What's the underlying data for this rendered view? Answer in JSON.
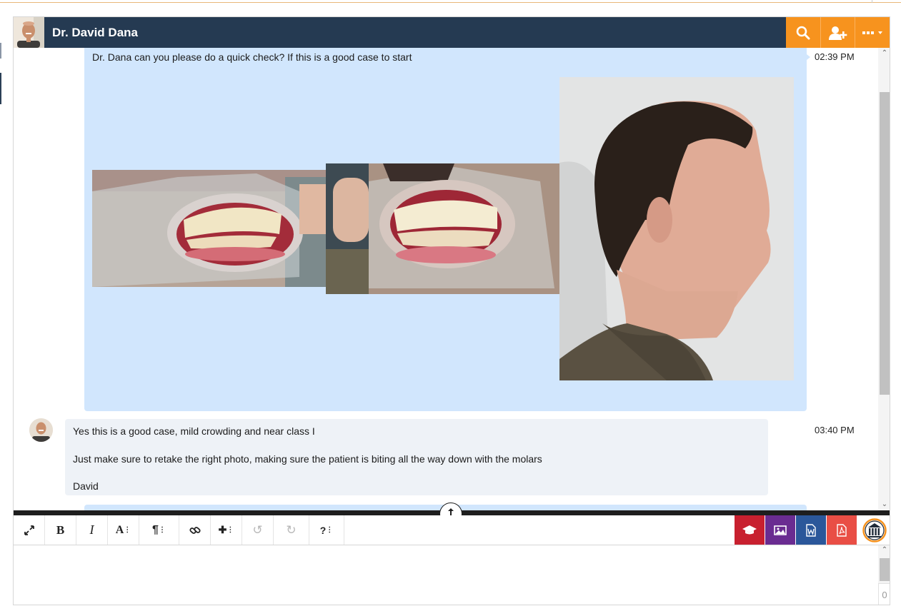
{
  "header": {
    "contact_name": "Dr. David Dana",
    "buttons": [
      {
        "icon": "search-icon"
      },
      {
        "icon": "add-user-icon"
      },
      {
        "icon": "more-options-icon"
      }
    ],
    "accent_color": "#f7931e",
    "bar_color": "#253a52"
  },
  "messages": [
    {
      "sender": "outgoing",
      "text": "Dr. Dana can you please do a quick check? If this is a good case to start",
      "time": "02:39 PM",
      "attachments": [
        {
          "type": "photo",
          "subject": "intraoral left side view"
        },
        {
          "type": "photo",
          "subject": "intraoral right side view"
        },
        {
          "type": "photo",
          "subject": "profile photo of patient"
        }
      ],
      "bubble_color": "#d1e6fd"
    },
    {
      "sender": "Dr. David Dana",
      "lines": [
        "Yes this is a good case, mild crowding and near class I",
        "Just make sure to retake the right photo, making sure the patient is biting all the way down with the molars",
        "David"
      ],
      "time": "03:40 PM",
      "bubble_color": "#eef2f7"
    }
  ],
  "toolbar": {
    "format_tools": [
      {
        "name": "fullscreen-icon"
      },
      {
        "name": "bold-icon",
        "glyph": "B"
      },
      {
        "name": "italic-icon",
        "glyph": "I"
      },
      {
        "name": "font-size-icon",
        "glyph": "A"
      },
      {
        "name": "paragraph-icon",
        "glyph": "¶"
      },
      {
        "name": "link-icon"
      },
      {
        "name": "insert-icon",
        "glyph": "✚"
      },
      {
        "name": "undo-icon",
        "glyph": "↺",
        "disabled": true
      },
      {
        "name": "redo-icon",
        "glyph": "↻",
        "disabled": true
      },
      {
        "name": "help-icon",
        "glyph": "?"
      }
    ],
    "export_buttons": [
      {
        "name": "education-export-icon",
        "color": "#c8202f"
      },
      {
        "name": "image-export-icon",
        "color": "#6a2c91"
      },
      {
        "name": "word-export-icon",
        "color": "#2b579a"
      },
      {
        "name": "pdf-export-icon",
        "color": "#e94e45"
      },
      {
        "name": "institution-icon",
        "color": "#f7931e"
      }
    ]
  },
  "editor": {
    "char_count": "0"
  }
}
